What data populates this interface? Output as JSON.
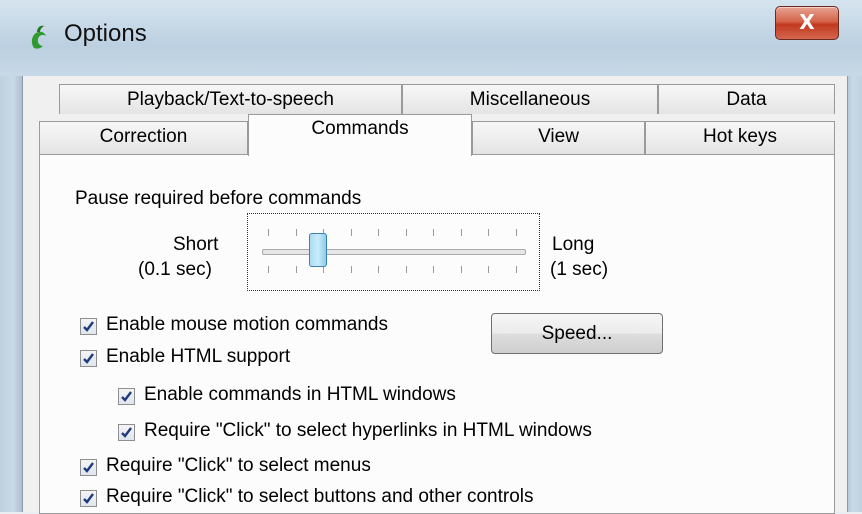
{
  "window": {
    "title": "Options",
    "close_label": "X",
    "app_icon": "dragon-icon"
  },
  "tabs": {
    "row1": [
      {
        "label": "Playback/Text-to-speech"
      },
      {
        "label": "Miscellaneous"
      },
      {
        "label": "Data"
      }
    ],
    "row2": [
      {
        "label": "Correction"
      },
      {
        "label": "Commands",
        "selected": true
      },
      {
        "label": "View"
      },
      {
        "label": "Hot keys"
      }
    ]
  },
  "pause": {
    "label": "Pause required before commands",
    "min_label": "Short",
    "min_value": "(0.1 sec)",
    "max_label": "Long",
    "max_value": "(1 sec)",
    "slider_level": 0.2,
    "tick_count": 10
  },
  "speed_button": {
    "label": "Speed..."
  },
  "options": [
    {
      "text": "Enable mouse motion commands",
      "checked": true
    },
    {
      "text": "Enable HTML support",
      "checked": true
    },
    {
      "text": "Enable commands in HTML windows",
      "checked": true
    },
    {
      "text": "Require \"Click\" to select hyperlinks in HTML windows",
      "checked": true
    },
    {
      "text": "Require \"Click\" to select menus",
      "checked": true
    },
    {
      "text": "Require \"Click\" to select buttons and other controls",
      "checked": true
    }
  ],
  "colors": {
    "close_button": "#c2391f",
    "slider_thumb": "#a9dcf3",
    "check_mark": "#1f3a80"
  }
}
